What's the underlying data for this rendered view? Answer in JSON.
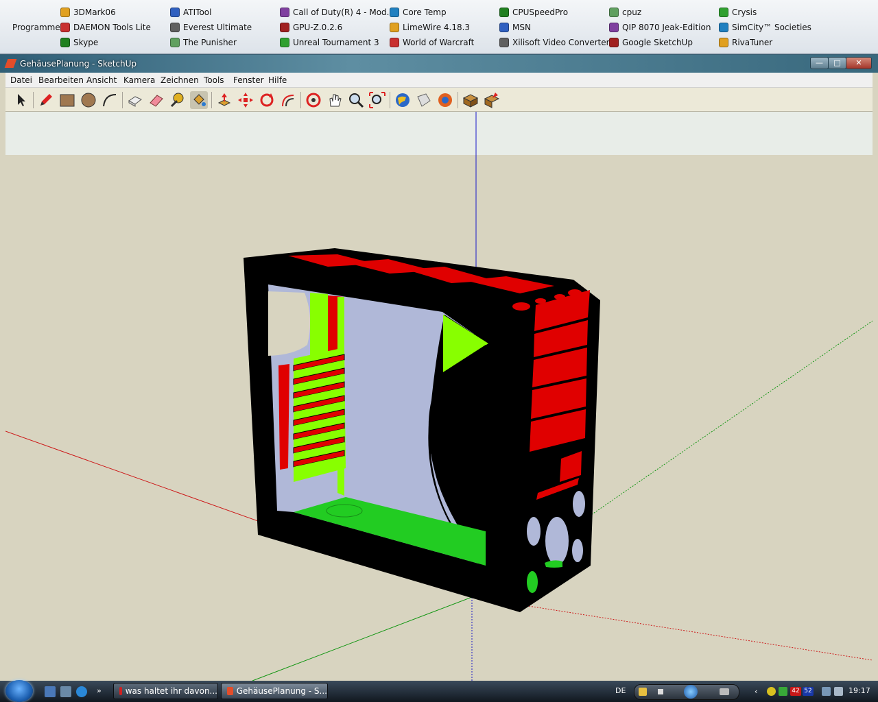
{
  "programs_bar": {
    "label": "Programme",
    "columns": [
      [
        "3DMark06",
        "DAEMON Tools Lite",
        "Skype"
      ],
      [
        "ATITool",
        "Everest Ultimate",
        "The Punisher"
      ],
      [
        "Call of Duty(R) 4 - Mod...",
        "GPU-Z.0.2.6",
        "Unreal Tournament 3"
      ],
      [
        "Core Temp",
        "LimeWire 4.18.3",
        "World of Warcraft"
      ],
      [
        "CPUSpeedPro",
        "MSN",
        "Xilisoft Video Converter..."
      ],
      [
        "cpuz",
        "QIP 8070 Jeak-Edition",
        "Google SketchUp"
      ],
      [
        "Crysis",
        "SimCity™ Societies",
        "RivaTuner"
      ]
    ]
  },
  "window": {
    "title": "GehäusePlanung - SketchUp",
    "controls": {
      "minimize": "—",
      "maximize": "□",
      "close": "✕"
    }
  },
  "menu": [
    "Datei",
    "Bearbeiten",
    "Ansicht",
    "Kamera",
    "Zeichnen",
    "Tools",
    "Fenster",
    "Hilfe"
  ],
  "toolbar_tools": [
    "select-icon",
    "pencil-icon",
    "rectangle-icon",
    "circle-icon",
    "arc-icon",
    "make-component-icon",
    "eraser-icon",
    "tape-measure-icon",
    "paint-bucket-icon",
    "push-pull-icon",
    "move-icon",
    "rotate-icon",
    "offset-icon",
    "orbit-icon",
    "pan-icon",
    "zoom-icon",
    "zoom-extents-icon",
    "get-models-icon",
    "share-model-icon",
    "google-earth-icon",
    "component-icon",
    "extension-icon"
  ],
  "colors": {
    "sky": "#e8ede8",
    "ground": "#d8d4c0",
    "case_black": "#000000",
    "accent_red": "#e00000",
    "accent_green": "#88ff00",
    "panel_blue": "#b0b8d8"
  },
  "taskbar": {
    "tasks": [
      "was haltet ihr davon...",
      "GehäusePlanung - S..."
    ],
    "language": "DE",
    "clock": "19:17",
    "cpu_temps": [
      "42",
      "52"
    ]
  }
}
